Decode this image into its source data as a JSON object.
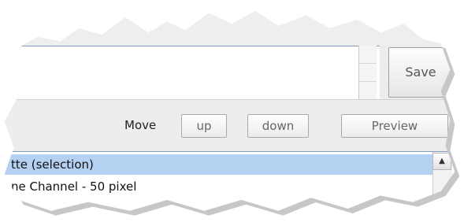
{
  "editor": {
    "save_label": "Save"
  },
  "toolbar": {
    "move_label": "Move",
    "up_label": "up",
    "down_label": "down",
    "preview_label": "Preview"
  },
  "list": {
    "items": [
      {
        "label": "tte (selection)",
        "selected": true
      },
      {
        "label": "ne Channel - 50 pixel",
        "selected": false
      }
    ],
    "scroll_up_icon": "▲"
  },
  "colors": {
    "selection": "#b5d1f2",
    "panel": "#ededed"
  }
}
